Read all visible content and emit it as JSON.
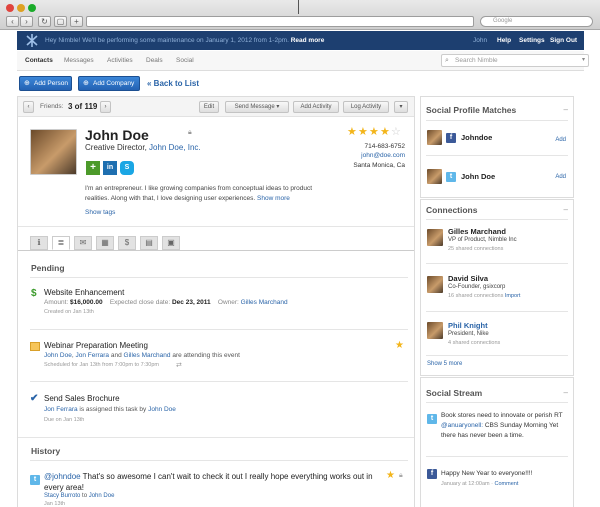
{
  "browser": {
    "search_placeholder": "Google"
  },
  "topbar": {
    "message": "Hey Nimble! We'll be performing some maintenance on January 1, 2012 from 1-2pm.",
    "read_more": "Read more",
    "user": "John",
    "help": "Help",
    "settings": "Settings",
    "sign_out": "Sign Out"
  },
  "tabs": [
    "Contacts",
    "Messages",
    "Activities",
    "Deals",
    "Social"
  ],
  "search": {
    "placeholder": "Search Nimble"
  },
  "actions": {
    "add_person": "Add Person",
    "add_company": "Add Company",
    "back": "« Back to List"
  },
  "pager": {
    "label": "Friends:",
    "current": "3 of 119"
  },
  "toolbar": {
    "edit": "Edit",
    "send_message": "Send Message",
    "add_activity": "Add Activity",
    "log_activity": "Log Activity"
  },
  "contact": {
    "name": "John Doe",
    "title_prefix": "Creative Director,",
    "company": "John Doe, Inc.",
    "phone": "714-683-6752",
    "email": "john@doe.com",
    "location": "Santa Monica, Ca",
    "rating": 4,
    "rating_max": 5,
    "bio": "I'm an entrepreneur. I like growing companies from conceptual ideas to product realities. Along with that, I love designing user experiences.",
    "show_more": "Show more",
    "show_tags": "Show tags"
  },
  "pending": {
    "heading": "Pending",
    "items": [
      {
        "title": "Website Enhancement",
        "amount_label": "Amount:",
        "amount": "$16,000.00",
        "close_label": "Expected close date:",
        "close_date": "Dec 23, 2011",
        "owner_label": "Owner:",
        "owner": "Gilles Marchand",
        "meta": "Created on Jan 13th"
      },
      {
        "title": "Webinar Preparation Meeting",
        "p1": "John Doe",
        "p2": "Jon Ferrara",
        "and": "and",
        "p3": "Gilles Marchand",
        "suffix": "are attending this event",
        "meta": "Scheduled for Jan 13th from 7:00pm to 7:30pm"
      },
      {
        "title": "Send Sales Brochure",
        "assignee": "Jon Ferrara",
        "mid": "is assigned this task by",
        "assigner": "John Doe",
        "meta": "Due on Jan 13th"
      }
    ]
  },
  "history": {
    "heading": "History",
    "items": [
      {
        "handle": "@johndoe",
        "text": "That's so awesome I can't wait to check it out I really hope everything works out in every area!",
        "from": "Stacy Burroto",
        "to_word": "to",
        "to": "John Doe",
        "meta": "Jan 13th"
      }
    ]
  },
  "social_matches": {
    "heading": "Social Profile Matches",
    "items": [
      {
        "network": "facebook",
        "name": "Johndoe",
        "action": "Add"
      },
      {
        "network": "twitter",
        "name": "John Doe",
        "action": "Add"
      }
    ]
  },
  "connections": {
    "heading": "Connections",
    "items": [
      {
        "name": "Gilles Marchand",
        "role": "VP of Product, Nimble Inc",
        "meta": "25 shared connections",
        "link": ""
      },
      {
        "name": "David Silva",
        "role": "Co-Founder, gsixcorp",
        "meta": "16 shared connections",
        "link": "Import"
      },
      {
        "name": "Phil Knight",
        "role": "President, Nike",
        "meta": "4 shared connections",
        "link": ""
      }
    ],
    "show_more": "Show 5 more"
  },
  "social_stream": {
    "heading": "Social Stream",
    "items": [
      {
        "network": "twitter",
        "text1": "Book stores need to innovate or perish RT",
        "handle": "@anuaryonell:",
        "text2": "CBS Sunday Morning Yet there has never been a time."
      },
      {
        "network": "facebook",
        "text1": "Happy New Year to everyone!!!!",
        "meta": "January at 12:00am ·",
        "link": "Comment"
      }
    ]
  }
}
